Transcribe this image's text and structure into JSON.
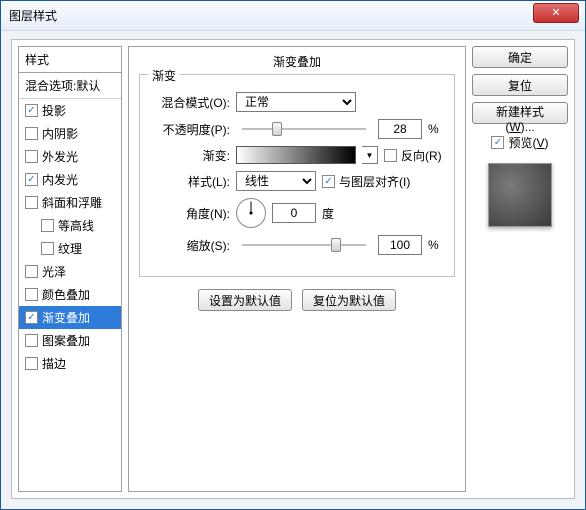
{
  "window": {
    "title": "图层样式"
  },
  "styles_panel": {
    "header": "样式",
    "sub": "混合选项:默认",
    "items": [
      {
        "label": "投影",
        "checked": true,
        "indent": false
      },
      {
        "label": "内阴影",
        "checked": false,
        "indent": false
      },
      {
        "label": "外发光",
        "checked": false,
        "indent": false
      },
      {
        "label": "内发光",
        "checked": true,
        "indent": false
      },
      {
        "label": "斜面和浮雕",
        "checked": false,
        "indent": false
      },
      {
        "label": "等高线",
        "checked": false,
        "indent": true
      },
      {
        "label": "纹理",
        "checked": false,
        "indent": true
      },
      {
        "label": "光泽",
        "checked": false,
        "indent": false
      },
      {
        "label": "颜色叠加",
        "checked": false,
        "indent": false
      },
      {
        "label": "渐变叠加",
        "checked": true,
        "indent": false,
        "selected": true
      },
      {
        "label": "图案叠加",
        "checked": false,
        "indent": false
      },
      {
        "label": "描边",
        "checked": false,
        "indent": false
      }
    ]
  },
  "main": {
    "title": "渐变叠加",
    "legend": "渐变",
    "blend_label": "混合模式(O):",
    "blend_value": "正常",
    "opacity_label": "不透明度(P):",
    "opacity_value": "28",
    "opacity_unit": "%",
    "gradient_label": "渐变:",
    "reverse_label": "反向(R)",
    "style_label": "样式(L):",
    "style_value": "线性",
    "align_label": "与图层对齐(I)",
    "angle_label": "角度(N):",
    "angle_value": "0",
    "angle_unit": "度",
    "scale_label": "缩放(S):",
    "scale_value": "100",
    "scale_unit": "%",
    "btn_default": "设置为默认值",
    "btn_reset": "复位为默认值"
  },
  "right": {
    "ok": "确定",
    "cancel": "复位",
    "newstyle": "新建样式(W)...",
    "preview_label": "预览(V)"
  }
}
